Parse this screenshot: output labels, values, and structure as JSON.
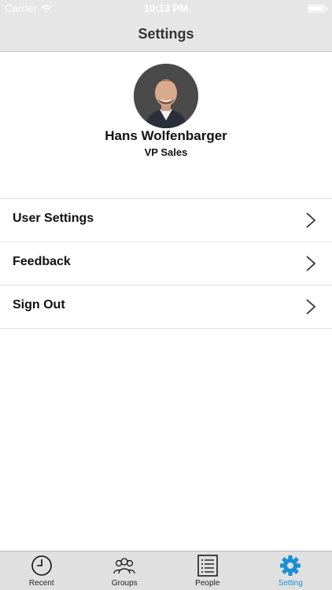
{
  "status_bar": {
    "carrier": "Carrier",
    "time": "10:13 PM"
  },
  "nav": {
    "title": "Settings"
  },
  "profile": {
    "name": "Hans Wolfenbarger",
    "job_title": "VP Sales"
  },
  "menu": {
    "items": [
      {
        "label": "User Settings"
      },
      {
        "label": "Feedback"
      },
      {
        "label": "Sign Out"
      }
    ]
  },
  "tab_bar": {
    "tabs": [
      {
        "label": "Recent",
        "icon": "clock-icon"
      },
      {
        "label": "Groups",
        "icon": "groups-icon"
      },
      {
        "label": "People",
        "icon": "list-icon"
      },
      {
        "label": "Setting",
        "icon": "gear-icon"
      }
    ],
    "active_tab": "Setting"
  },
  "colors": {
    "accent": "#1a8fd6",
    "bar_background": "#e6e6e6"
  }
}
